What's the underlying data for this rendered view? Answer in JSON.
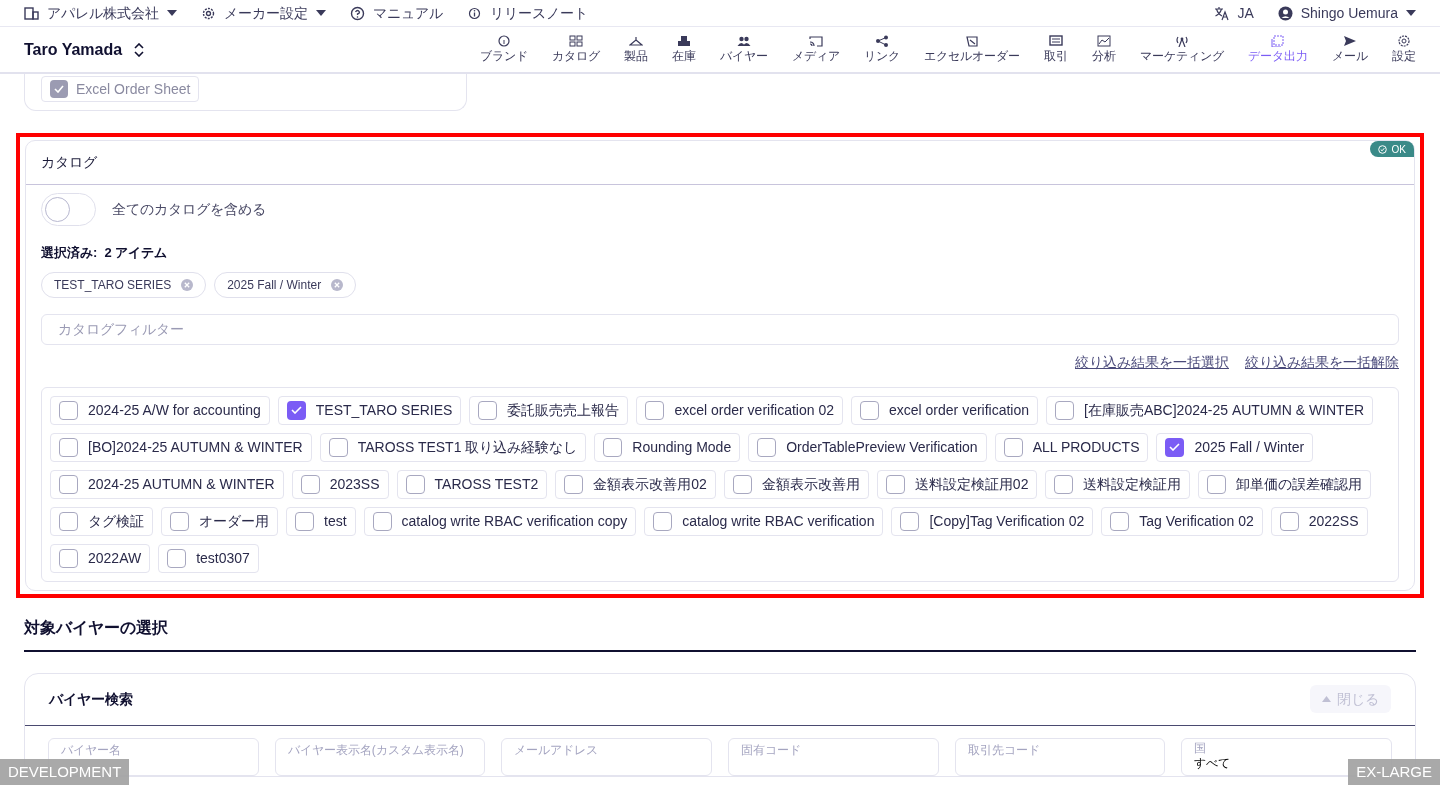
{
  "top_bar": {
    "items": [
      {
        "label": "アパレル株式会社",
        "dropdown": true
      },
      {
        "label": "メーカー設定",
        "dropdown": true
      },
      {
        "label": "マニュアル",
        "dropdown": false
      },
      {
        "label": "リリースノート",
        "dropdown": false
      }
    ],
    "language": "JA",
    "user": "Shingo Uemura"
  },
  "header": {
    "title": "Taro Yamada",
    "nav": [
      {
        "label": "ブランド",
        "selected": false
      },
      {
        "label": "カタログ",
        "selected": false
      },
      {
        "label": "製品",
        "selected": false
      },
      {
        "label": "在庫",
        "selected": false
      },
      {
        "label": "バイヤー",
        "selected": false
      },
      {
        "label": "メディア",
        "selected": false
      },
      {
        "label": "リンク",
        "selected": false
      },
      {
        "label": "エクセルオーダー",
        "selected": false
      },
      {
        "label": "取引",
        "selected": false
      },
      {
        "label": "分析",
        "selected": false
      },
      {
        "label": "マーケティング",
        "selected": false
      },
      {
        "label": "データ出力",
        "selected": true
      },
      {
        "label": "メール",
        "selected": false
      },
      {
        "label": "設定",
        "selected": false
      }
    ]
  },
  "previous_section": {
    "checkbox": {
      "label": "Excel Order Sheet",
      "checked": true,
      "disabled": true
    }
  },
  "catalog_panel": {
    "title": "カタログ",
    "status_badge": "OK",
    "include_all": {
      "label": "全てのカタログを含める",
      "on": false
    },
    "selected_label": "選択済み:  2 アイテム",
    "selected_chips": [
      "TEST_TARO SERIES",
      "2025 Fall / Winter"
    ],
    "filter": {
      "placeholder": "カタログフィルター"
    },
    "bulk_links": [
      "絞り込み結果を一括選択",
      "絞り込み結果を一括解除"
    ],
    "catalogs": [
      {
        "label": "2024-25 A/W for accounting",
        "checked": false
      },
      {
        "label": "TEST_TARO SERIES",
        "checked": true
      },
      {
        "label": "委託販売売上報告",
        "checked": false
      },
      {
        "label": "excel order verification 02",
        "checked": false
      },
      {
        "label": "excel order verification",
        "checked": false
      },
      {
        "label": "[在庫販売ABC]2024-25 AUTUMN & WINTER",
        "checked": false
      },
      {
        "label": "[BO]2024-25 AUTUMN & WINTER",
        "checked": false
      },
      {
        "label": "TAROSS TEST1 取り込み経験なし",
        "checked": false
      },
      {
        "label": "Rounding Mode",
        "checked": false
      },
      {
        "label": "OrderTablePreview Verification",
        "checked": false
      },
      {
        "label": "ALL PRODUCTS",
        "checked": false
      },
      {
        "label": "2025 Fall / Winter",
        "checked": true
      },
      {
        "label": "2024-25 AUTUMN & WINTER",
        "checked": false
      },
      {
        "label": "2023SS",
        "checked": false
      },
      {
        "label": "TAROSS TEST2",
        "checked": false
      },
      {
        "label": "金額表示改善用02",
        "checked": false
      },
      {
        "label": "金額表示改善用",
        "checked": false
      },
      {
        "label": "送料設定検証用02",
        "checked": false
      },
      {
        "label": "送料設定検証用",
        "checked": false
      },
      {
        "label": "卸単価の誤差確認用",
        "checked": false
      },
      {
        "label": "タグ検証",
        "checked": false
      },
      {
        "label": "オーダー用",
        "checked": false
      },
      {
        "label": "test",
        "checked": false
      },
      {
        "label": "catalog write RBAC verification copy",
        "checked": false
      },
      {
        "label": "catalog write RBAC verification",
        "checked": false
      },
      {
        "label": "[Copy]Tag Verification 02",
        "checked": false
      },
      {
        "label": "Tag Verification 02",
        "checked": false
      },
      {
        "label": "2022SS",
        "checked": false
      },
      {
        "label": "2022AW",
        "checked": false
      },
      {
        "label": "test0307",
        "checked": false
      }
    ]
  },
  "buyer_section": {
    "heading": "対象バイヤーの選択",
    "panel": {
      "title": "バイヤー検索",
      "close_button": "閉じる",
      "fields": [
        {
          "placeholder": "バイヤー名"
        },
        {
          "placeholder": "バイヤー表示名(カスタム表示名)"
        },
        {
          "placeholder": "メールアドレス"
        },
        {
          "placeholder": "固有コード"
        },
        {
          "placeholder": "取引先コード"
        }
      ],
      "country": {
        "label": "国",
        "value": "すべて"
      }
    }
  },
  "environment_badges": {
    "left": "DEVELOPMENT",
    "right": "EX-LARGE"
  }
}
